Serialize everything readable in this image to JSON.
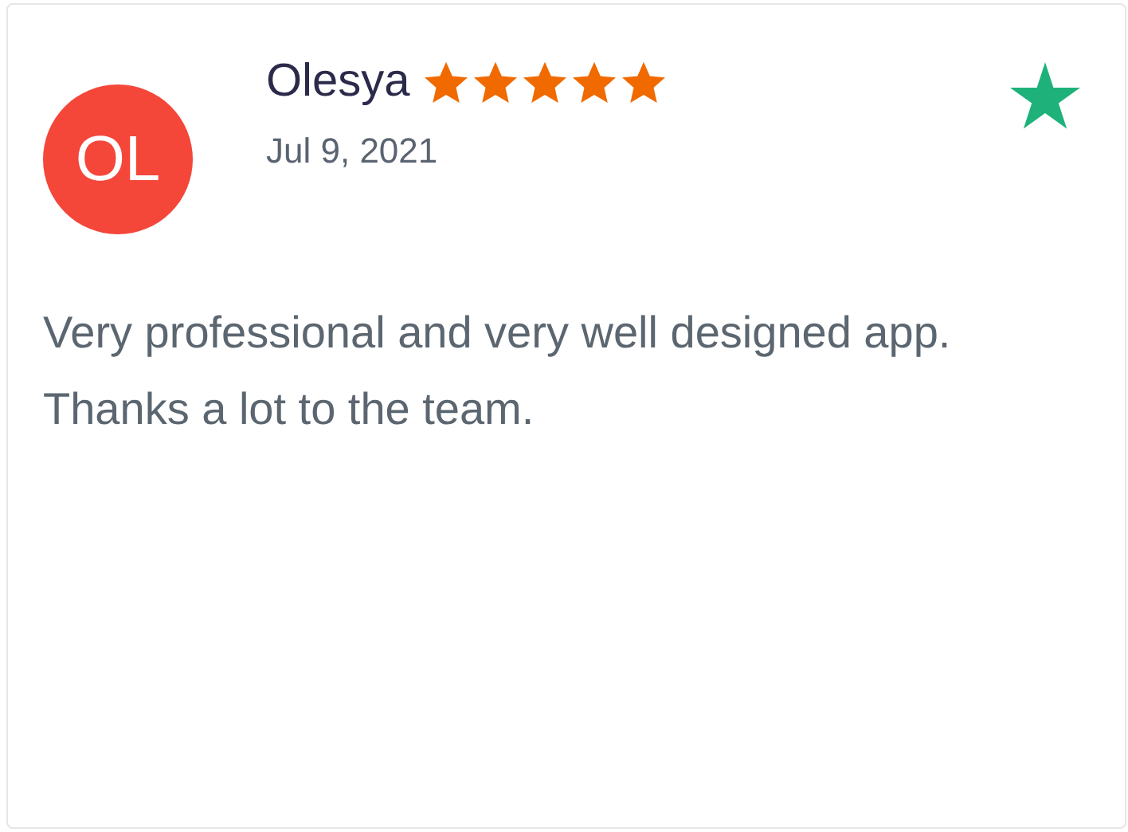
{
  "review": {
    "initials": "OL",
    "name": "Olesya",
    "stars": 5,
    "date": "Jul 9, 2021",
    "text": "Very professional and very well designed app. Thanks a lot to the team."
  }
}
